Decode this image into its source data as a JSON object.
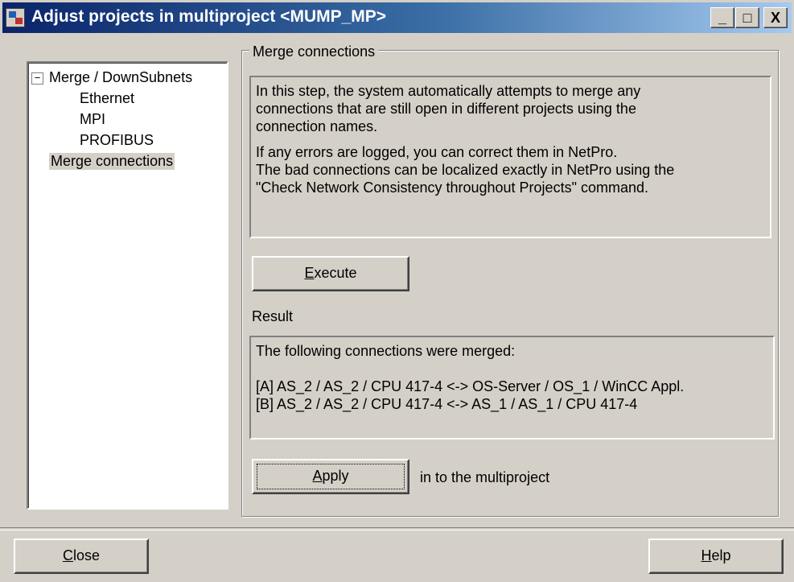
{
  "window": {
    "title": "Adjust projects in multiproject <MUMP_MP>"
  },
  "titlebar_buttons": {
    "minimize": "_",
    "maximize": "□",
    "close": "X"
  },
  "tree": {
    "expander": "−",
    "root": "Merge / DownSubnets",
    "children": [
      "Ethernet",
      "MPI",
      "PROFIBUS"
    ],
    "selected": "Merge connections"
  },
  "main": {
    "group_title": "Merge connections",
    "description_p1": "In this step, the system automatically attempts to merge any\nconnections that are still open in different projects using the\nconnection names.",
    "description_p2": "If any errors are logged, you can correct them in NetPro.\nThe bad connections can be localized exactly in NetPro using the\n\"Check Network Consistency throughout Projects\" command.",
    "execute_accel": "E",
    "execute_rest": "xecute",
    "result_label": "Result",
    "result_header": "The following connections were merged:",
    "result_lines": [
      "[A] AS_2 / AS_2 / CPU 417-4 <-> OS-Server / OS_1 / WinCC Appl.",
      "[B] AS_2 / AS_2 / CPU 417-4 <-> AS_1 / AS_1 / CPU 417-4"
    ],
    "apply_accel": "A",
    "apply_rest": "pply",
    "apply_suffix": "in to the multiproject"
  },
  "footer": {
    "close_accel": "C",
    "close_rest": "lose",
    "help_accel": "H",
    "help_rest": "elp"
  }
}
